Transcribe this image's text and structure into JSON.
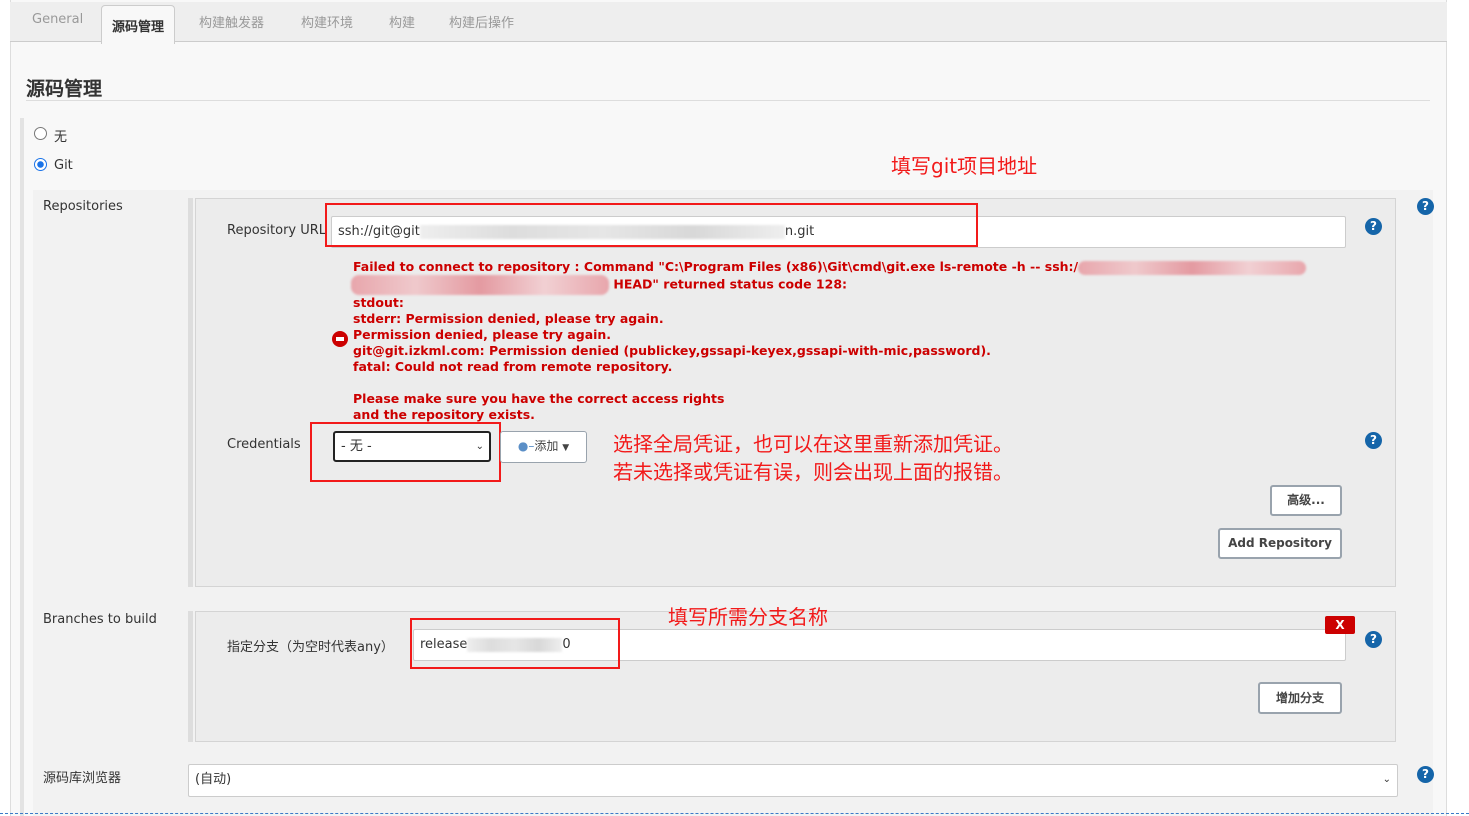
{
  "tabs": [
    {
      "label": "General"
    },
    {
      "label": "源码管理",
      "active": true
    },
    {
      "label": "构建触发器"
    },
    {
      "label": "构建环境"
    },
    {
      "label": "构建"
    },
    {
      "label": "构建后操作"
    }
  ],
  "section_title": "源码管理",
  "scm_options": [
    {
      "label": "无",
      "selected": false
    },
    {
      "label": "Git",
      "selected": true
    }
  ],
  "repositories": {
    "label": "Repositories",
    "url_label": "Repository URL",
    "url_prefix": "ssh://git@git",
    "url_suffix": "n.git",
    "error": {
      "line1": "Failed to connect to repository : Command \"C:\\Program Files (x86)\\Git\\cmd\\git.exe ls-remote -h -- ssh:/",
      "line2": "HEAD\" returned status code 128:",
      "line3": "stdout:",
      "line4": "stderr: Permission denied, please try again.",
      "line5": "Permission denied, please try again.",
      "line6": "git@git.izkml.com: Permission denied (publickey,gssapi-keyex,gssapi-with-mic,password).",
      "line7": "fatal: Could not read from remote repository.",
      "line8": "Please make sure you have the correct access rights",
      "line9": "and the repository exists."
    },
    "credentials_label": "Credentials",
    "credentials_value": "- 无 -",
    "add_label": "添加",
    "advanced_label": "高级...",
    "add_repository_label": "Add Repository"
  },
  "branches": {
    "label": "Branches to build",
    "spec_label": "指定分支（为空时代表any）",
    "value_prefix": "release",
    "value_suffix": "0",
    "delete_label": "X",
    "add_branch_label": "增加分支"
  },
  "browser": {
    "label": "源码库浏览器",
    "value": "(自动)"
  },
  "annotations": {
    "git_url": "填写git项目地址",
    "credentials_1": "选择全局凭证，也可以在这里重新添加凭证。",
    "credentials_2": "若未选择或凭证有误，则会出现上面的报错。",
    "branch": "填写所需分支名称"
  },
  "colors": {
    "error": "#cc0000",
    "annotation": "#f21a1a",
    "help": "#1565a9"
  }
}
